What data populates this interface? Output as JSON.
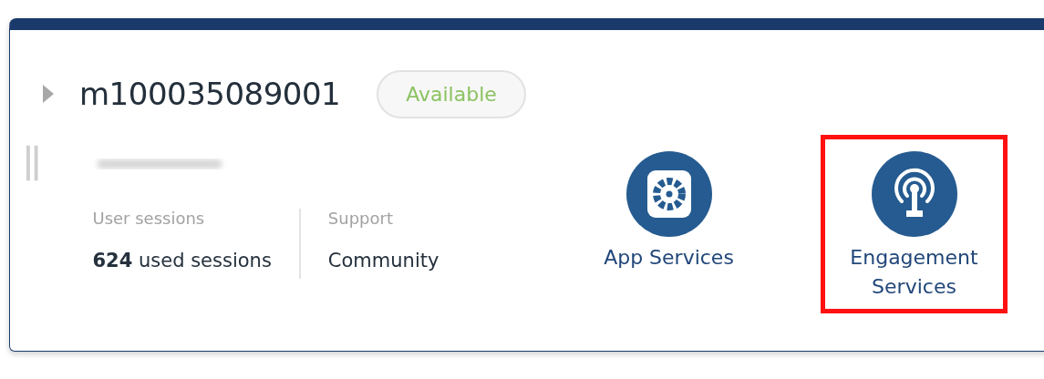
{
  "card": {
    "expanded": false,
    "title": "m100035089001",
    "status": "Available",
    "subtitle_redacted": true,
    "stats": [
      {
        "label": "User sessions",
        "value": "**624** used sessions"
      },
      {
        "label": "Support",
        "value": "Community"
      }
    ],
    "services": [
      {
        "kind": "app",
        "label": "App Services",
        "highlighted": false
      },
      {
        "kind": "engagement",
        "label": "Engagement Services",
        "highlighted": true
      }
    ]
  }
}
